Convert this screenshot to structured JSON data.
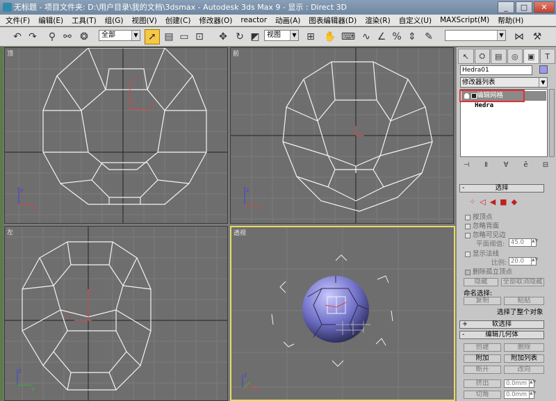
{
  "window": {
    "title": "无标题 - 项目文件夹: D:\\用户目录\\我的文档\\3dsmax - Autodesk 3ds Max 9 - 显示 : Direct 3D",
    "minimize": "_",
    "maximize": "□",
    "close": "✕"
  },
  "menu": [
    "文件(F)",
    "编辑(E)",
    "工具(T)",
    "组(G)",
    "视图(V)",
    "创建(C)",
    "修改器(O)",
    "reactor",
    "动画(A)",
    "图表编辑器(D)",
    "渲染(R)",
    "自定义(U)",
    "MAXScript(M)",
    "帮助(H)"
  ],
  "toolbar": {
    "filter_value": "全部",
    "view_value": "视图",
    "named_sel_value": ""
  },
  "viewports": {
    "top": "顶",
    "front": "前",
    "left": "左",
    "persp": "透视"
  },
  "gizmo": {
    "x": "x",
    "y": "y",
    "z": "z"
  },
  "panel": {
    "tabs": [
      "↖",
      "⛭",
      "▤",
      "◎",
      "▣",
      "T"
    ],
    "object_name": "Hedra01",
    "object_color": "#9999ee",
    "modifier_list": "修改器列表",
    "stack": {
      "item1": "编辑网格",
      "item2": "Hedra"
    },
    "selection": {
      "title": "选择",
      "by_vertex": "按顶点",
      "ignore_backfacing": "忽略背面",
      "ignore_visible_edges": "忽略可见边",
      "planar_thresh_label": "平面阈值:",
      "planar_thresh": "45.0",
      "show_normals": "显示法线",
      "scale_label": "比例:",
      "scale": "20.0",
      "delete_isolated": "删除孤立顶点",
      "hide": "隐藏",
      "unhide_all": "全部取消隐藏",
      "named_selections": "命名选择:",
      "copy": "复制",
      "paste": "粘贴",
      "status": "选择了整个对象"
    },
    "soft_selection": "软选择",
    "edit_geometry": {
      "title": "编辑几何体",
      "create": "创建",
      "delete": "删除",
      "attach": "附加",
      "attach_list": "附加列表",
      "detach": "断开",
      "turn": "改向",
      "extrude": "挤出",
      "extrude_val": "0.0mm",
      "chamfer": "切角",
      "chamfer_val": "0.0mm"
    }
  }
}
